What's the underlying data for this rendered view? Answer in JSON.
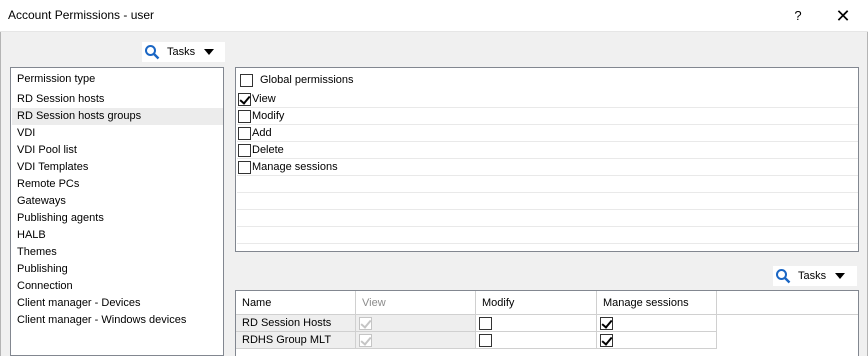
{
  "window": {
    "title": "Account Permissions - user",
    "help_label": "?",
    "close_label": "✕"
  },
  "tasks_top": {
    "label": "Tasks"
  },
  "tasks_bottom": {
    "label": "Tasks"
  },
  "permission_type": {
    "header": "Permission type",
    "selected": "RD Session hosts groups",
    "items": [
      "RD Session hosts",
      "RD Session hosts groups",
      "VDI",
      "VDI Pool list",
      "VDI Templates",
      "Remote PCs",
      "Gateways",
      "Publishing agents",
      "HALB",
      "Themes",
      "Publishing",
      "Connection",
      "Client manager - Devices",
      "Client manager - Windows devices"
    ]
  },
  "permissions": {
    "global_label": "Global permissions",
    "global_checked": false,
    "items": [
      {
        "label": "View",
        "checked": true
      },
      {
        "label": "Modify",
        "checked": false
      },
      {
        "label": "Add",
        "checked": false
      },
      {
        "label": "Delete",
        "checked": false
      },
      {
        "label": "Manage sessions",
        "checked": false
      }
    ]
  },
  "grid": {
    "columns": [
      "Name",
      "View",
      "Modify",
      "Manage sessions"
    ],
    "rows": [
      {
        "name": "RD Session Hosts",
        "view": true,
        "modify": false,
        "manage_sessions": true
      },
      {
        "name": "RDHS Group MLT",
        "view": true,
        "modify": false,
        "manage_sessions": true
      }
    ]
  },
  "icons": {
    "search": "magnifier-icon",
    "dropdown": "triangle-down-icon"
  }
}
